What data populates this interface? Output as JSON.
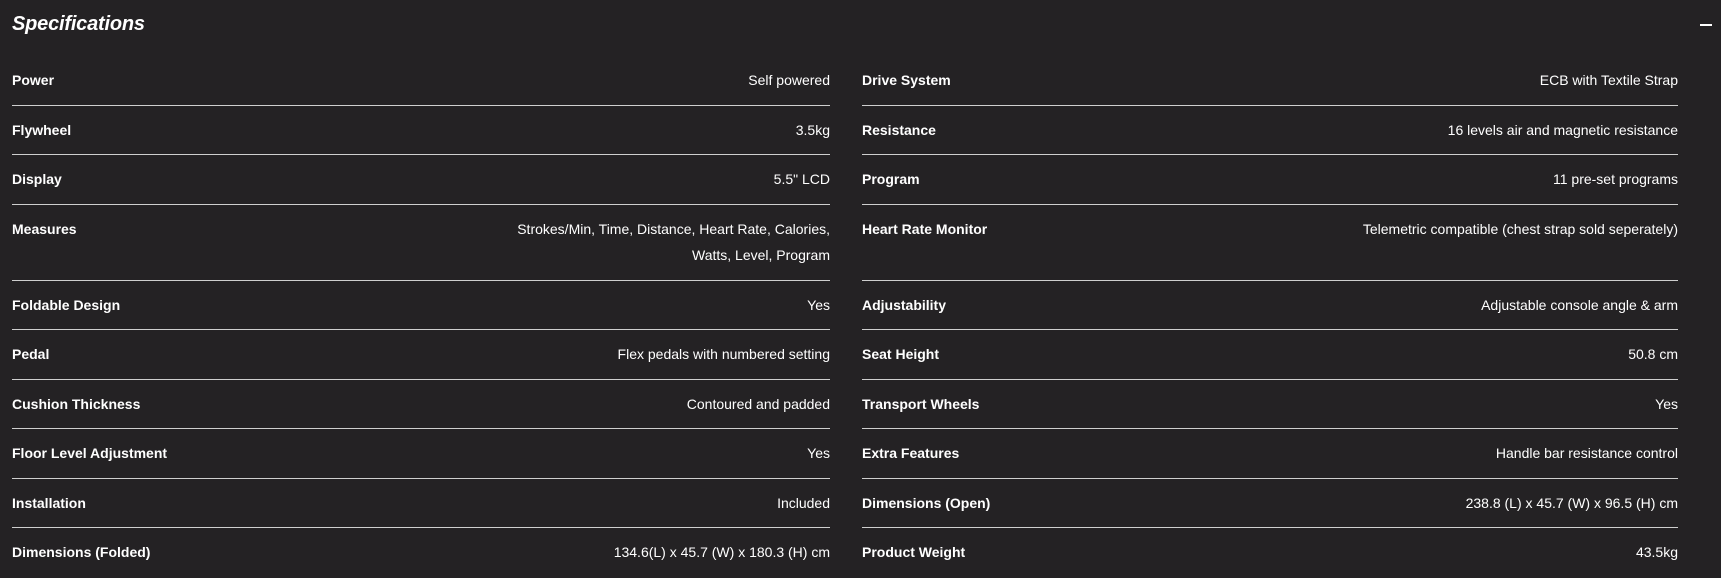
{
  "section": {
    "title": "Specifications",
    "collapse_icon": "minus-icon"
  },
  "left": [
    {
      "label": "Power",
      "value": "Self powered"
    },
    {
      "label": "Flywheel",
      "value": "3.5kg"
    },
    {
      "label": "Display",
      "value": "5.5\" LCD"
    },
    {
      "label": "Measures",
      "value": "Strokes/Min, Time, Distance, Heart Rate, Calories, Watts, Level, Program"
    },
    {
      "label": "Foldable Design",
      "value": "Yes"
    },
    {
      "label": "Pedal",
      "value": "Flex pedals with numbered setting"
    },
    {
      "label": "Cushion Thickness",
      "value": "Contoured and padded"
    },
    {
      "label": "Floor Level Adjustment",
      "value": "Yes"
    },
    {
      "label": "Installation",
      "value": "Included"
    },
    {
      "label": "Dimensions (Folded)",
      "value": "134.6(L) x 45.7 (W) x 180.3 (H) cm"
    }
  ],
  "right": [
    {
      "label": "Drive System",
      "value": "ECB with Textile Strap"
    },
    {
      "label": "Resistance",
      "value": "16 levels air and magnetic resistance"
    },
    {
      "label": "Program",
      "value": "11 pre-set programs"
    },
    {
      "label": "Heart Rate Monitor",
      "value": "Telemetric compatible (chest strap sold seperately)"
    },
    {
      "label": "Adjustability",
      "value": "Adjustable console angle & arm"
    },
    {
      "label": "Seat Height",
      "value": "50.8 cm"
    },
    {
      "label": "Transport Wheels",
      "value": "Yes"
    },
    {
      "label": "Extra Features",
      "value": "Handle bar resistance control"
    },
    {
      "label": "Dimensions (Open)",
      "value": "238.8 (L) x 45.7 (W) x 96.5 (H) cm"
    },
    {
      "label": "Product Weight",
      "value": "43.5kg"
    }
  ]
}
